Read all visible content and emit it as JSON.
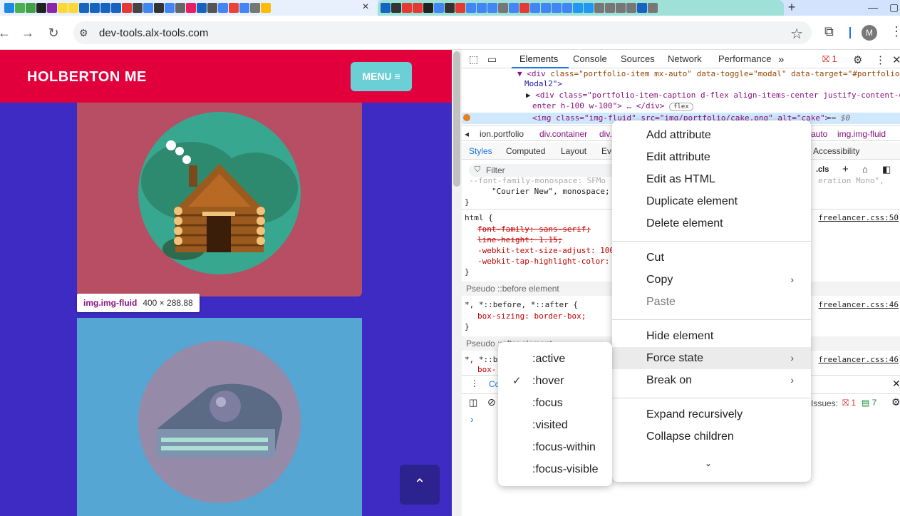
{
  "browser": {
    "tab_close": "×",
    "new_tab": "+",
    "url": "dev-tools.alx-tools.com",
    "profile_initial": "M",
    "tab_labels": [
      "133",
      "88",
      "TS",
      "TS",
      "TS"
    ]
  },
  "page": {
    "brand": "HOLBERTON ME",
    "menu_label": "MENU ≡",
    "tooltip_tag": "img.img-fluid",
    "tooltip_dims": "400 × 288.88",
    "scroll_top_icon": "⌃"
  },
  "devtools": {
    "tabs": [
      "Elements",
      "Console",
      "Sources",
      "Network",
      "Performance"
    ],
    "more_tabs": "»",
    "error_count": "1",
    "dom": {
      "line1_open": "<div ",
      "line1_attrs": "class=\"portfolio-item mx-auto\" data-toggle=\"modal\" data-target=\"#portfolio",
      "line1_wrap": "Modal2\">",
      "line2": "<div class=\"portfolio-item-caption d-flex align-items-center justify-content-c",
      "line2_wrap": "enter h-100 w-100\"> … </div>",
      "flex_badge": "flex",
      "selected": "<img class=\"img-fluid\" src=\"img/portfolio/cake.png\" alt=\"cake\">",
      "selected_marker": "== $0"
    },
    "breadcrumbs": [
      "ion.portfolio",
      "div.container",
      "div.",
      "auto",
      "img.img-fluid"
    ],
    "subtabs": [
      "Styles",
      "Computed",
      "Layout",
      "Ev",
      "Accessibility"
    ],
    "filter_placeholder": "Filter",
    "filter_cls": ".cls",
    "styles": {
      "mono_line": "--font-family-monospace: SFMo",
      "mono_line_tail": "eration Mono\",",
      "mono_line2": "\"Courier New\", monospace;",
      "brace_close": "}",
      "html_rule": "html {",
      "html_link": "freelancer.css:50",
      "prop1": "font-family: sans-serif;",
      "prop2": "line-height: 1.15;",
      "prop3": "-webkit-text-size-adjust: 100",
      "prop4": "-webkit-tap-highlight-color:",
      "pseudo_before": "Pseudo ::before element",
      "before_rule": "*, *::before, *::after {",
      "before_link": "freelancer.css:46",
      "before_prop": "box-sizing: border-box;",
      "pseudo_after": "Pseudo ::after element",
      "after_rule": "*, *::b",
      "after_link": "freelancer.css:46",
      "after_prop": "box-"
    },
    "drawer_label": "Co",
    "issues_label": "Issues:",
    "issues_errors": "1",
    "issues_msgs": "7",
    "console_prompt": "›"
  },
  "context_menu": {
    "items": [
      "Add attribute",
      "Edit attribute",
      "Edit as HTML",
      "Duplicate element",
      "Delete element",
      "Cut",
      "Copy",
      "Paste",
      "Hide element",
      "Force state",
      "Break on",
      "Expand recursively",
      "Collapse children"
    ],
    "more": "⌄"
  },
  "force_state_menu": {
    "items": [
      ":active",
      ":hover",
      ":focus",
      ":visited",
      ":focus-within",
      ":focus-visible"
    ],
    "checked": ":hover",
    "check_mark": "✓"
  }
}
